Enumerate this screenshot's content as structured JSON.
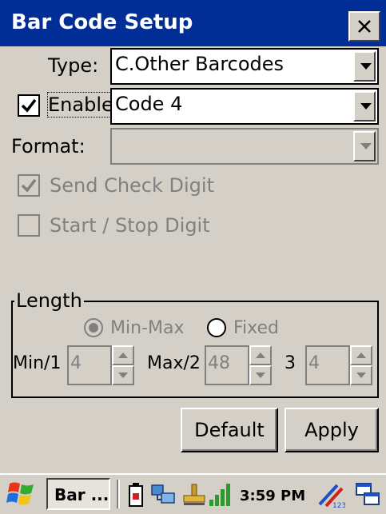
{
  "window": {
    "title": "Bar Code Setup",
    "close_label": "×"
  },
  "type_field": {
    "label": "Type:",
    "value": "C.Other Barcodes"
  },
  "enable_field": {
    "label": "Enable",
    "checked": true,
    "value": "Code 4"
  },
  "format_field": {
    "label": "Format:",
    "value": ""
  },
  "send_check_digit": {
    "label": "Send Check Digit",
    "checked": true,
    "enabled": false
  },
  "start_stop_digit": {
    "label": "Start / Stop Digit",
    "checked": false,
    "enabled": false
  },
  "length_group": {
    "label": "Length",
    "min_max_label": "Min-Max",
    "fixed_label": "Fixed",
    "selected": "Min-Max",
    "min_label": "Min/1",
    "min_value": "4",
    "max_label": "Max/2",
    "max_value": "48",
    "third_label": "3",
    "third_value": "4"
  },
  "buttons": {
    "default_label": "Default",
    "apply_label": "Apply"
  },
  "taskbar": {
    "app_label": "Bar ...",
    "time": "3:59 PM"
  },
  "colors": {
    "titlebar": "#002d96",
    "face": "#d4d0c8",
    "disabled_text": "#808080"
  }
}
